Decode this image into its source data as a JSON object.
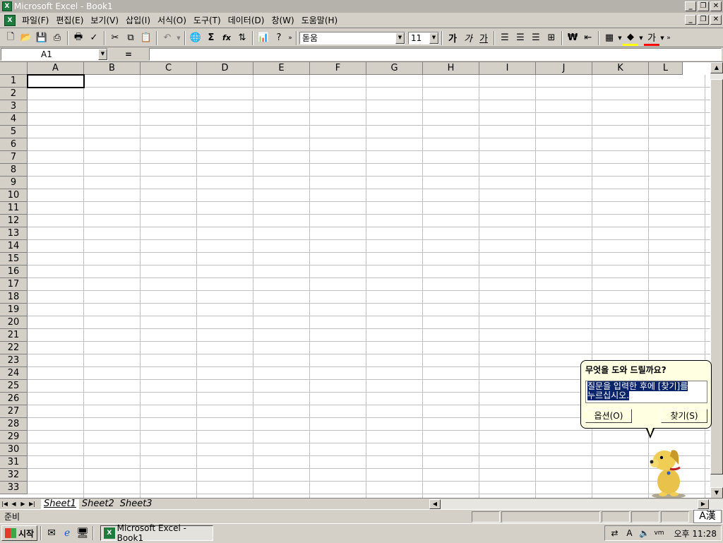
{
  "window": {
    "title": "Microsoft Excel - Book1",
    "app_icon": "X"
  },
  "menu": [
    "파일(F)",
    "편집(E)",
    "보기(V)",
    "삽입(I)",
    "서식(O)",
    "도구(T)",
    "데이터(D)",
    "창(W)",
    "도움말(H)"
  ],
  "toolbar": {
    "font_name": "돋움",
    "font_size": "11",
    "icons": [
      "new-icon",
      "open-icon",
      "save-icon",
      "print-icon",
      "print-preview-icon",
      "spellcheck-icon",
      "cut-icon",
      "copy-icon",
      "paste-icon",
      "undo-icon",
      "hyperlink-icon",
      "autosum-icon",
      "function-icon",
      "sort-icon",
      "chart-icon",
      "help-icon",
      "bold-icon",
      "italic-icon",
      "underline-icon",
      "align-left-icon",
      "align-center-icon",
      "align-right-icon",
      "merge-icon",
      "currency-icon",
      "indent-icon",
      "borders-icon",
      "fill-color-icon",
      "font-color-icon"
    ],
    "bold_glyph": "가",
    "italic_glyph": "가",
    "underline_glyph": "가",
    "font_color_glyph": "가",
    "autosum_glyph": "Σ",
    "function_glyph": "fx"
  },
  "formula_bar": {
    "name_box": "A1",
    "equals": "=",
    "value": ""
  },
  "columns": [
    "A",
    "B",
    "C",
    "D",
    "E",
    "F",
    "G",
    "H",
    "I",
    "J",
    "K",
    "L"
  ],
  "rows": [
    "1",
    "2",
    "3",
    "4",
    "5",
    "6",
    "7",
    "8",
    "9",
    "10",
    "11",
    "12",
    "13",
    "14",
    "15",
    "16",
    "17",
    "18",
    "19",
    "20",
    "21",
    "22",
    "23",
    "24",
    "25",
    "26",
    "27",
    "28",
    "29",
    "30",
    "31",
    "32",
    "33"
  ],
  "sheets": [
    "Sheet1",
    "Sheet2",
    "Sheet3"
  ],
  "active_sheet": "Sheet1",
  "status": {
    "text": "준비",
    "ime": "A漢"
  },
  "assistant": {
    "question": "무엇을 도와 드릴까요?",
    "prompt_line1": "질문을 입력한 후에 [찾기]를",
    "prompt_line2": "누르십시오.",
    "options_button": "옵션(O)",
    "search_button": "찾기(S)"
  },
  "taskbar": {
    "start_label": "시작",
    "task_label": "Microsoft Excel - Book1",
    "clock": "오후 11:28"
  }
}
